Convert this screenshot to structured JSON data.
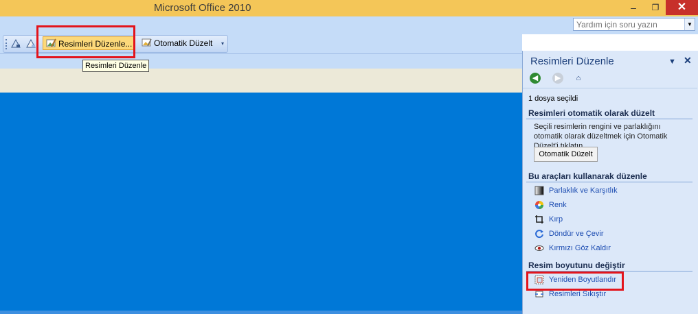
{
  "window": {
    "title": "Microsoft Office 2010",
    "minimize": "–",
    "maximize": "❐",
    "close": "✕"
  },
  "help": {
    "placeholder": "Yardım için soru yazın",
    "dropdown": "▼"
  },
  "toolbar": {
    "edit_pictures_label": "Resimleri Düzenle...",
    "auto_correct_label": "Otomatik Düzelt",
    "overflow": "▾"
  },
  "tooltip": {
    "text": "Resimleri Düzenle"
  },
  "task_pane": {
    "title": "Resimleri Düzenle",
    "dropdown": "▼",
    "close": "✕",
    "nav_back": "◀",
    "nav_forward": "▶",
    "nav_home": "⌂",
    "selected_count": "1 dosya seçildi",
    "auto_section": {
      "title": "Resimleri otomatik olarak düzelt",
      "description": "Seçili resimlerin rengini ve parlaklığını otomatik olarak düzeltmek için Otomatik Düzelt'i tıklatın.",
      "button": "Otomatik  Düzelt"
    },
    "tools_section": {
      "title": "Bu araçları kullanarak düzenle",
      "items": [
        {
          "label": "Parlaklık ve Karşıtlık",
          "icon": "brightness-contrast-icon"
        },
        {
          "label": "Renk",
          "icon": "color-wheel-icon"
        },
        {
          "label": "Kırp",
          "icon": "crop-icon"
        },
        {
          "label": "Döndür ve Çevir",
          "icon": "rotate-flip-icon"
        },
        {
          "label": "Kırmızı Göz Kaldır",
          "icon": "red-eye-icon"
        }
      ]
    },
    "size_section": {
      "title": "Resim boyutunu değiştir",
      "items": [
        {
          "label": "Yeniden Boyutlandır",
          "icon": "resize-icon"
        },
        {
          "label": "Resimleri Sıkıştır",
          "icon": "compress-icon"
        }
      ]
    }
  },
  "colors": {
    "titlebar": "#f4c658",
    "toolbar": "#c5dcf8",
    "canvas": "#0078d7",
    "pane": "#dce8f9",
    "highlight": "#e3141c",
    "link": "#1b4bb1"
  }
}
